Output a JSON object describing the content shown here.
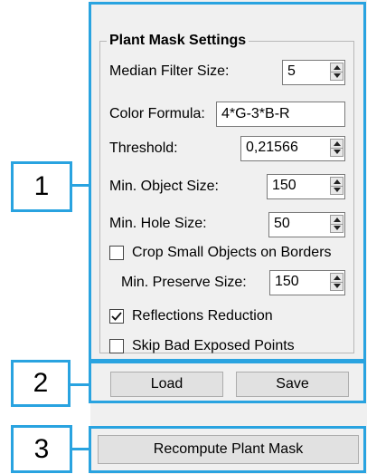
{
  "colors": {
    "annotation": "#29a3e0",
    "dialog_background": "#f0f0f0",
    "button_background": "#e1e1e1"
  },
  "annotations": {
    "label_1": "1",
    "label_2": "2",
    "label_3": "3"
  },
  "plant_mask_settings": {
    "title": "Plant Mask Settings",
    "median_filter": {
      "label": "Median Filter Size:",
      "value": "5"
    },
    "color_formula": {
      "label": "Color Formula:",
      "value": "4*G-3*B-R"
    },
    "threshold": {
      "label": "Threshold:",
      "value": "0,21566"
    },
    "min_object_size": {
      "label": "Min. Object Size:",
      "value": "150"
    },
    "min_hole_size": {
      "label": "Min. Hole Size:",
      "value": "50"
    },
    "crop_small_objects": {
      "label": "Crop Small Objects on Borders",
      "checked": false
    },
    "min_preserve_size": {
      "label": "Min. Preserve Size:",
      "value": "150"
    },
    "reflections_reduction": {
      "label": "Reflections Reduction",
      "checked": true
    },
    "skip_bad_exposed": {
      "label": "Skip Bad Exposed Points",
      "checked": false
    }
  },
  "buttons": {
    "load": "Load",
    "save": "Save",
    "recompute": "Recompute Plant Mask"
  },
  "icons": {
    "spin": "up-down-spinner-icon",
    "check": "checkmark-icon"
  }
}
